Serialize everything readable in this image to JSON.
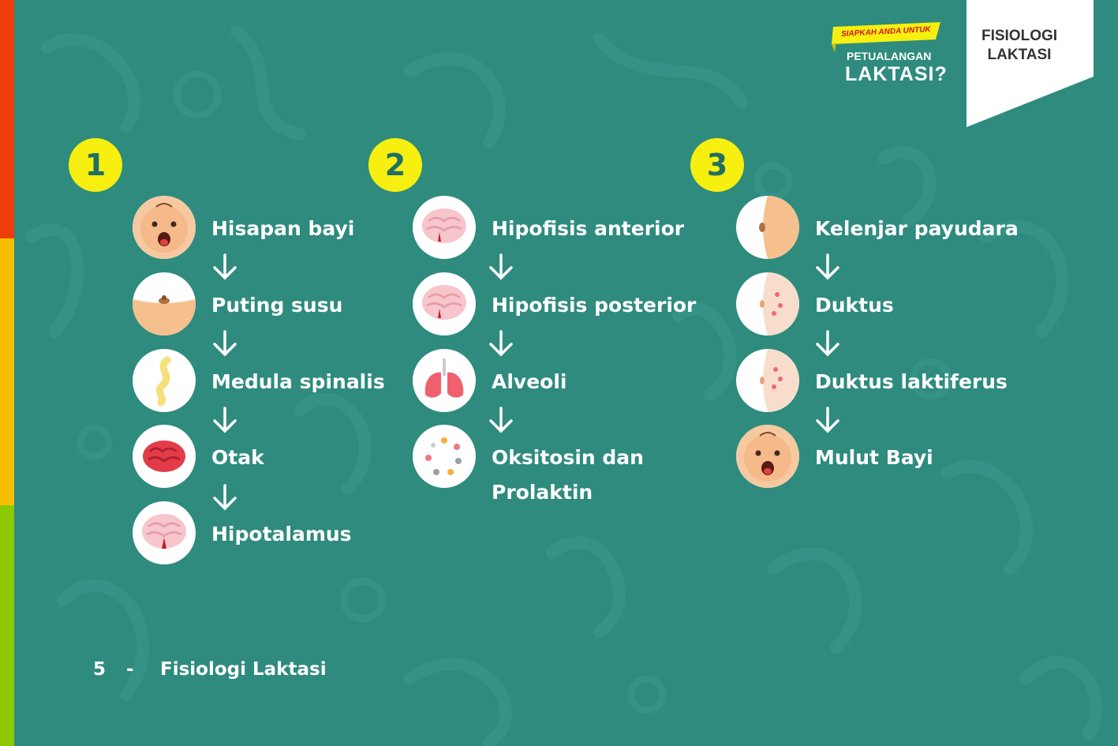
{
  "header": {
    "tag_line1": "FISIOLOGI",
    "tag_line2": "LAKTASI",
    "logo": {
      "small": "SIAPKAH ANDA UNTUK",
      "mid": "PETUALANGAN",
      "big": "LAKTASI?"
    }
  },
  "columns": [
    {
      "number": "1",
      "steps": [
        {
          "label": "Hisapan bayi",
          "icon": "baby-face-icon"
        },
        {
          "label": "Puting susu",
          "icon": "nipple-icon"
        },
        {
          "label": "Medula spinalis",
          "icon": "spinal-cord-icon"
        },
        {
          "label": "Otak",
          "icon": "brain-icon"
        },
        {
          "label": "Hipotalamus",
          "icon": "hypothalamus-icon"
        }
      ]
    },
    {
      "number": "2",
      "steps": [
        {
          "label": "Hipofisis anterior",
          "icon": "pituitary-icon"
        },
        {
          "label": "Hipofisis posterior",
          "icon": "pituitary-icon"
        },
        {
          "label": "Alveoli",
          "icon": "lungs-icon"
        },
        {
          "label": "Oksitosin dan Prolaktin",
          "icon": "hormone-dots-icon"
        }
      ]
    },
    {
      "number": "3",
      "steps": [
        {
          "label": "Kelenjar payudara",
          "icon": "breast-icon"
        },
        {
          "label": "Duktus",
          "icon": "duct-icon"
        },
        {
          "label": "Duktus laktiferus",
          "icon": "duct-icon"
        },
        {
          "label": "Mulut Bayi",
          "icon": "baby-face-icon"
        }
      ]
    }
  ],
  "footer": {
    "page": "5",
    "separator": "-",
    "title": "Fisiologi Laktasi"
  },
  "colors": {
    "background": "#2e8b7e",
    "number_badge": "#f6ef10",
    "stripe_top": "#ee3d0a",
    "stripe_mid": "#f7be00",
    "stripe_bottom": "#8cc900"
  }
}
